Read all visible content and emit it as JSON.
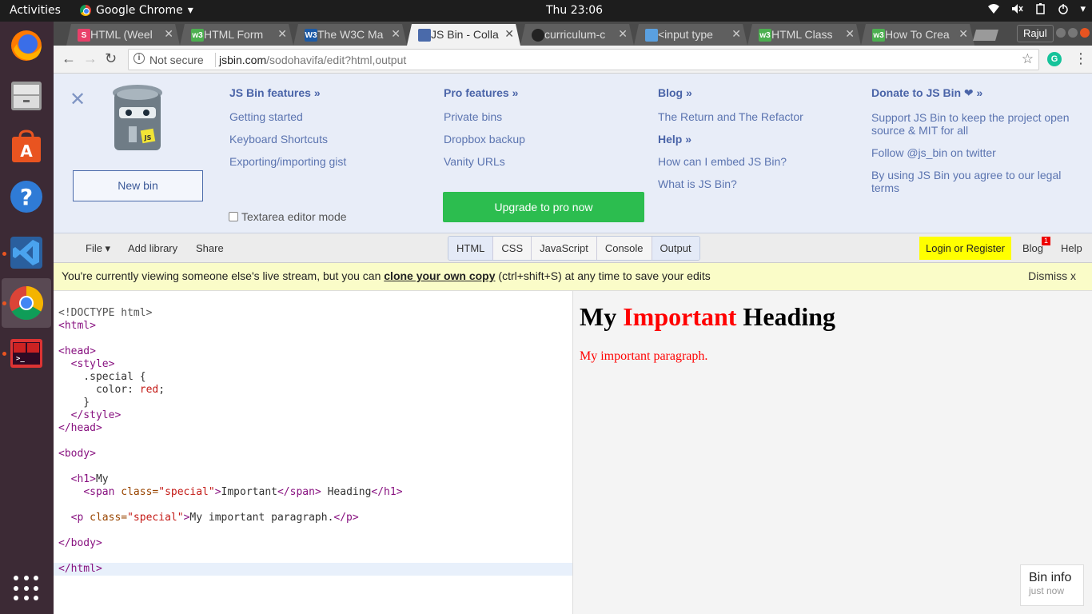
{
  "system": {
    "activities": "Activities",
    "app_name": "Google Chrome",
    "clock": "Thu 23:06"
  },
  "tabs": [
    {
      "label": "HTML (Weel",
      "fav_color": "#e9406a",
      "fav_text": "S"
    },
    {
      "label": "HTML Form",
      "fav_color": "#4caf50",
      "fav_text": "w3"
    },
    {
      "label": "The W3C Ma",
      "fav_color": "#1c5aa6",
      "fav_text": "W3"
    },
    {
      "label": "JS Bin - Colla",
      "fav_color": "#4a6aaa",
      "fav_text": ""
    },
    {
      "label": "curriculum-c",
      "fav_color": "#222222",
      "fav_text": ""
    },
    {
      "label": "<input type",
      "fav_color": "#5aa0e0",
      "fav_text": ""
    },
    {
      "label": "HTML Class",
      "fav_color": "#4caf50",
      "fav_text": "w3"
    },
    {
      "label": "How To Crea",
      "fav_color": "#4caf50",
      "fav_text": "w3"
    }
  ],
  "profile": "Rajul",
  "address": {
    "security": "Not secure",
    "host": "jsbin.com",
    "path": "/sodohavifa/edit?html,output"
  },
  "panel": {
    "new_bin": "New bin",
    "features_heading": "JS Bin features »",
    "features": [
      "Getting started",
      "Keyboard Shortcuts",
      "Exporting/importing gist"
    ],
    "textarea_mode": "Textarea editor mode",
    "pro_heading": "Pro features »",
    "pro": [
      "Private bins",
      "Dropbox backup",
      "Vanity URLs"
    ],
    "upgrade": "Upgrade to pro now",
    "blog_heading": "Blog »",
    "blog": [
      "The Return and The Refactor"
    ],
    "help_heading": "Help »",
    "help": [
      "How can I embed JS Bin?",
      "What is JS Bin?"
    ],
    "donate_heading": "Donate to JS Bin ❤ »",
    "donate": [
      "Support JS Bin to keep the project open source & MIT for all",
      "Follow @js_bin on twitter",
      "By using JS Bin you agree to our legal terms"
    ]
  },
  "toolbar": {
    "file": "File ▾",
    "add_library": "Add library",
    "share": "Share",
    "panels": [
      "HTML",
      "CSS",
      "JavaScript",
      "Console",
      "Output"
    ],
    "login": "Login or Register",
    "blog": "Blog",
    "blog_badge": "1",
    "help": "Help"
  },
  "notice": {
    "pre": "You're currently viewing someone else's live stream, but you can ",
    "link": "clone your own copy",
    "post": " (ctrl+shift+S) at any time to save your edits",
    "dismiss": "Dismiss x"
  },
  "output": {
    "h1_pre": "My ",
    "h1_special": "Important",
    "h1_post": " Heading",
    "paragraph": "My important paragraph."
  },
  "bin_info": {
    "title": "Bin info",
    "sub": "just now"
  }
}
